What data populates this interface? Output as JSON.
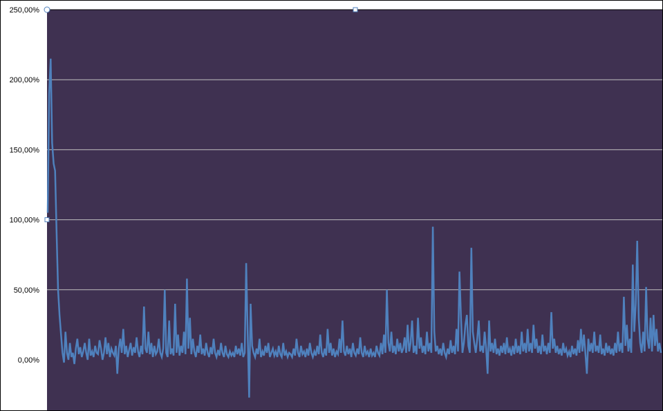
{
  "chart_data": {
    "type": "line",
    "title": "",
    "xlabel": "",
    "ylabel": "",
    "ylim": [
      -0.35,
      2.5
    ],
    "yticks": [
      0,
      0.5,
      1.0,
      1.5,
      2.0,
      2.5
    ],
    "ytick_labels": [
      "0,00%",
      "50,00%",
      "100,00%",
      "150,00%",
      "200,00%",
      "250,00%"
    ],
    "grid": true,
    "legend": "none",
    "colors": {
      "plot_background": "#3f3151",
      "series_line": "#4f81bd",
      "gridline": "#c0c0c0"
    },
    "series": [
      {
        "values": [
          1.05,
          1.9,
          2.15,
          1.55,
          1.4,
          1.35,
          0.9,
          0.5,
          0.32,
          0.18,
          0.05,
          -0.02,
          0.2,
          0.05,
          0.0,
          0.12,
          0.02,
          0.05,
          -0.03,
          0.08,
          0.15,
          0.04,
          0.09,
          0.02,
          0.06,
          0.12,
          0.05,
          0.0,
          0.15,
          0.03,
          0.06,
          0.02,
          0.1,
          0.05,
          0.04,
          0.14,
          0.08,
          0.0,
          0.05,
          0.16,
          0.04,
          0.12,
          0.02,
          0.08,
          0.05,
          0.03,
          0.1,
          -0.1,
          0.08,
          0.15,
          0.05,
          0.22,
          0.04,
          0.1,
          0.02,
          0.07,
          0.12,
          0.03,
          0.09,
          0.05,
          0.16,
          0.06,
          0.02,
          0.1,
          0.04,
          0.38,
          0.08,
          0.05,
          0.2,
          0.04,
          0.12,
          0.02,
          0.1,
          0.04,
          0.06,
          0.15,
          0.05,
          0.02,
          0.08,
          0.5,
          0.05,
          0.02,
          0.28,
          0.04,
          0.08,
          0.03,
          0.4,
          0.05,
          0.18,
          0.03,
          0.1,
          0.05,
          0.2,
          0.04,
          0.58,
          0.08,
          0.3,
          0.04,
          0.15,
          0.06,
          0.02,
          0.1,
          0.05,
          0.18,
          0.04,
          0.08,
          0.03,
          0.12,
          0.05,
          0.02,
          0.09,
          0.04,
          0.15,
          0.05,
          0.02,
          0.07,
          0.03,
          0.12,
          0.05,
          0.02,
          0.1,
          0.04,
          0.02,
          0.06,
          0.03,
          0.05,
          0.02,
          0.1,
          0.04,
          0.08,
          0.03,
          0.12,
          0.02,
          0.05,
          0.69,
          0.2,
          -0.27,
          0.4,
          0.1,
          0.05,
          0.02,
          0.08,
          0.04,
          0.15,
          0.02,
          0.06,
          0.03,
          0.1,
          0.05,
          0.12,
          0.02,
          0.05,
          0.08,
          0.03,
          0.06,
          0.02,
          0.1,
          0.04,
          0.02,
          0.12,
          0.03,
          0.06,
          0.02,
          0.05,
          0.04,
          0.02,
          0.08,
          0.03,
          0.15,
          0.05,
          0.02,
          0.1,
          0.04,
          0.06,
          0.02,
          0.08,
          0.03,
          0.12,
          0.05,
          0.02,
          0.06,
          0.03,
          0.1,
          0.04,
          0.18,
          0.05,
          0.02,
          0.08,
          0.03,
          0.22,
          0.05,
          0.12,
          0.03,
          0.08,
          0.02,
          0.06,
          0.04,
          0.15,
          0.05,
          0.28,
          0.06,
          0.03,
          0.1,
          0.04,
          0.08,
          0.02,
          0.12,
          0.05,
          0.03,
          0.08,
          0.04,
          0.16,
          0.05,
          0.02,
          0.1,
          0.04,
          0.06,
          0.02,
          0.08,
          0.03,
          0.05,
          0.02,
          0.1,
          0.05,
          0.03,
          0.12,
          0.04,
          0.18,
          0.05,
          0.5,
          0.12,
          0.06,
          0.2,
          0.05,
          0.1,
          0.04,
          0.15,
          0.06,
          0.12,
          0.05,
          0.08,
          0.16,
          0.05,
          0.25,
          0.06,
          0.12,
          0.28,
          0.05,
          0.1,
          0.04,
          0.3,
          0.08,
          0.16,
          0.05,
          0.1,
          0.04,
          0.2,
          0.06,
          0.12,
          0.05,
          0.95,
          0.2,
          0.06,
          0.1,
          0.04,
          0.08,
          0.03,
          0.12,
          0.05,
          0.02,
          0.08,
          0.04,
          0.14,
          0.05,
          0.1,
          0.04,
          0.22,
          0.06,
          0.63,
          0.3,
          0.05,
          0.12,
          0.25,
          0.32,
          0.1,
          0.05,
          0.8,
          0.2,
          0.12,
          0.05,
          0.15,
          0.28,
          0.06,
          0.1,
          0.05,
          0.2,
          0.08,
          -0.1,
          0.28,
          0.06,
          0.12,
          0.05,
          0.15,
          0.04,
          0.08,
          0.03,
          0.1,
          0.05,
          0.12,
          0.04,
          0.16,
          0.05,
          0.08,
          0.03,
          0.1,
          0.04,
          0.15,
          0.05,
          0.1,
          0.04,
          0.2,
          0.06,
          0.12,
          0.05,
          0.22,
          0.06,
          0.12,
          0.05,
          0.25,
          0.08,
          0.15,
          0.05,
          0.1,
          0.04,
          0.18,
          0.06,
          0.1,
          0.04,
          0.12,
          0.05,
          0.34,
          0.08,
          0.15,
          0.05,
          0.1,
          0.04,
          0.08,
          0.03,
          0.12,
          0.05,
          0.08,
          0.03,
          0.06,
          0.02,
          0.1,
          0.04,
          0.08,
          0.03,
          0.14,
          0.05,
          0.22,
          0.06,
          0.18,
          0.05,
          -0.1,
          0.15,
          0.06,
          0.12,
          0.05,
          0.2,
          0.06,
          0.1,
          0.05,
          0.18,
          0.04,
          0.08,
          0.03,
          0.12,
          0.05,
          0.1,
          0.04,
          0.08,
          0.03,
          0.12,
          0.05,
          0.2,
          0.06,
          0.12,
          0.05,
          0.45,
          0.1,
          0.25,
          0.06,
          0.15,
          0.05,
          0.68,
          0.2,
          0.4,
          0.85,
          0.3,
          0.12,
          0.05,
          0.2,
          0.06,
          0.52,
          0.15,
          0.08,
          0.3,
          0.06,
          0.32,
          0.1,
          0.22,
          0.06,
          0.12,
          0.05
        ]
      }
    ]
  },
  "ui": {
    "selection_handle_color": "#4f81bd"
  }
}
